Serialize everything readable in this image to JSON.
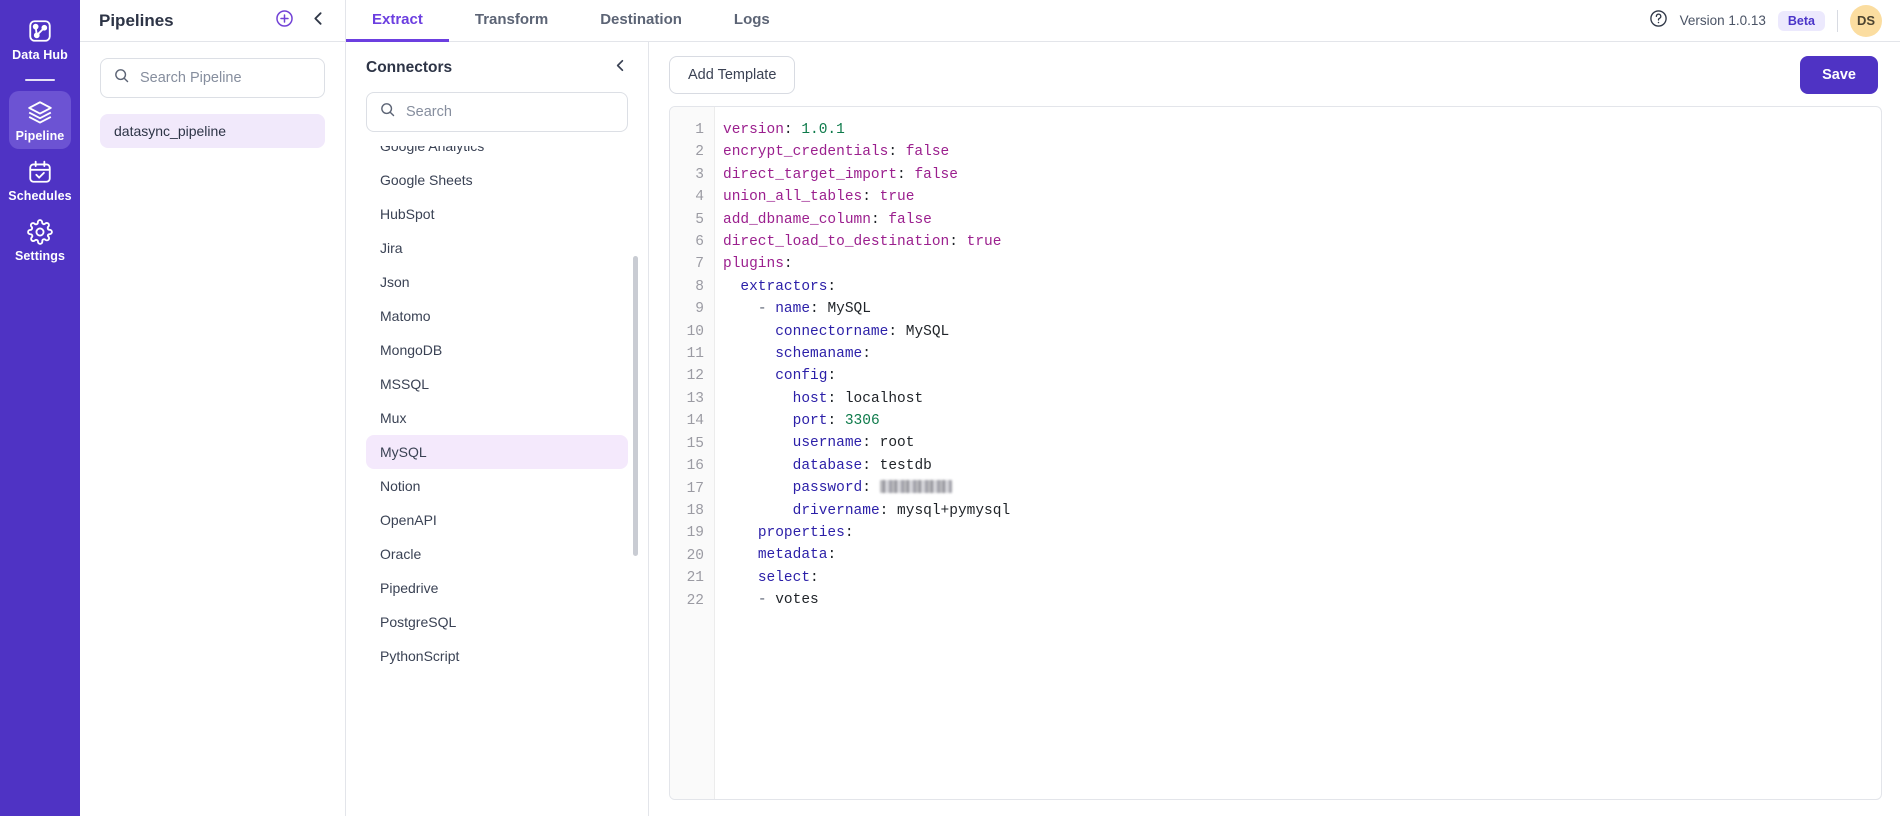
{
  "rail": {
    "items": [
      {
        "label": "Data Hub",
        "icon": "data-hub-icon",
        "active": false
      },
      {
        "label": "Pipeline",
        "icon": "layers-icon",
        "active": true
      },
      {
        "label": "Schedules",
        "icon": "calendar-check-icon",
        "active": false
      },
      {
        "label": "Settings",
        "icon": "gear-icon",
        "active": false
      }
    ]
  },
  "pipelines": {
    "title": "Pipelines",
    "add_icon": "plus-circle-icon",
    "collapse_icon": "chevron-left-icon",
    "search": {
      "value": "",
      "placeholder": "Search Pipeline",
      "icon": "search-icon"
    },
    "items": [
      {
        "label": "datasync_pipeline",
        "selected": true
      }
    ]
  },
  "header": {
    "tabs": [
      {
        "label": "Extract",
        "active": true
      },
      {
        "label": "Transform",
        "active": false
      },
      {
        "label": "Destination",
        "active": false
      },
      {
        "label": "Logs",
        "active": false
      }
    ],
    "help_icon": "question-circle-icon",
    "version": "Version 1.0.13",
    "badge": "Beta",
    "avatar": "DS"
  },
  "connectors": {
    "title": "Connectors",
    "collapse_icon": "chevron-left-icon",
    "search": {
      "value": "",
      "placeholder": "Search",
      "icon": "search-icon"
    },
    "items": [
      {
        "label": "Google Analytics",
        "selected": false
      },
      {
        "label": "Google Sheets",
        "selected": false
      },
      {
        "label": "HubSpot",
        "selected": false
      },
      {
        "label": "Jira",
        "selected": false
      },
      {
        "label": "Json",
        "selected": false
      },
      {
        "label": "Matomo",
        "selected": false
      },
      {
        "label": "MongoDB",
        "selected": false
      },
      {
        "label": "MSSQL",
        "selected": false
      },
      {
        "label": "Mux",
        "selected": false
      },
      {
        "label": "MySQL",
        "selected": true
      },
      {
        "label": "Notion",
        "selected": false
      },
      {
        "label": "OpenAPI",
        "selected": false
      },
      {
        "label": "Oracle",
        "selected": false
      },
      {
        "label": "Pipedrive",
        "selected": false
      },
      {
        "label": "PostgreSQL",
        "selected": false
      },
      {
        "label": "PythonScript",
        "selected": false
      }
    ]
  },
  "editor": {
    "add_template_label": "Add Template",
    "save_label": "Save",
    "line_numbers": [
      1,
      2,
      3,
      4,
      5,
      6,
      7,
      8,
      9,
      10,
      11,
      12,
      13,
      14,
      15,
      16,
      17,
      18,
      19,
      20,
      21,
      22
    ],
    "lines": [
      {
        "n": 1,
        "indent": 0,
        "key": "version",
        "value": "1.0.1",
        "type": "num"
      },
      {
        "n": 2,
        "indent": 0,
        "key": "encrypt_credentials",
        "value": "false",
        "type": "bool"
      },
      {
        "n": 3,
        "indent": 0,
        "key": "direct_target_import",
        "value": "false",
        "type": "bool"
      },
      {
        "n": 4,
        "indent": 0,
        "key": "union_all_tables",
        "value": "true",
        "type": "bool"
      },
      {
        "n": 5,
        "indent": 0,
        "key": "add_dbname_column",
        "value": "false",
        "type": "bool"
      },
      {
        "n": 6,
        "indent": 0,
        "key": "direct_load_to_destination",
        "value": "true",
        "type": "bool"
      },
      {
        "n": 7,
        "indent": 0,
        "key": "plugins",
        "value": "",
        "type": "none"
      },
      {
        "n": 8,
        "indent": 1,
        "key": "extractors",
        "value": "",
        "type": "none"
      },
      {
        "n": 9,
        "indent": 2,
        "key": "name",
        "value": "MySQL",
        "type": "str",
        "dash": true
      },
      {
        "n": 10,
        "indent": 3,
        "key": "connectorname",
        "value": "MySQL",
        "type": "str"
      },
      {
        "n": 11,
        "indent": 3,
        "key": "schemaname",
        "value": "",
        "type": "none"
      },
      {
        "n": 12,
        "indent": 3,
        "key": "config",
        "value": "",
        "type": "none"
      },
      {
        "n": 13,
        "indent": 4,
        "key": "host",
        "value": "localhost",
        "type": "str"
      },
      {
        "n": 14,
        "indent": 4,
        "key": "port",
        "value": "3306",
        "type": "num"
      },
      {
        "n": 15,
        "indent": 4,
        "key": "username",
        "value": "root",
        "type": "str"
      },
      {
        "n": 16,
        "indent": 4,
        "key": "database",
        "value": "testdb",
        "type": "str"
      },
      {
        "n": 17,
        "indent": 4,
        "key": "password",
        "value": "",
        "type": "redacted"
      },
      {
        "n": 18,
        "indent": 4,
        "key": "drivername",
        "value": "mysql+pymysql",
        "type": "str"
      },
      {
        "n": 19,
        "indent": 2,
        "key": "properties",
        "value": "",
        "type": "none"
      },
      {
        "n": 20,
        "indent": 2,
        "key": "metadata",
        "value": "",
        "type": "none"
      },
      {
        "n": 21,
        "indent": 2,
        "key": "select",
        "value": "",
        "type": "none"
      },
      {
        "n": 22,
        "indent": 2,
        "key": "",
        "value": "votes",
        "type": "item",
        "dash": true
      }
    ]
  },
  "colors": {
    "rail_bg": "#4f33c4",
    "accent": "#6c3fe0",
    "selection": "#f1e9fb",
    "avatar_bg": "#fbdda0"
  }
}
